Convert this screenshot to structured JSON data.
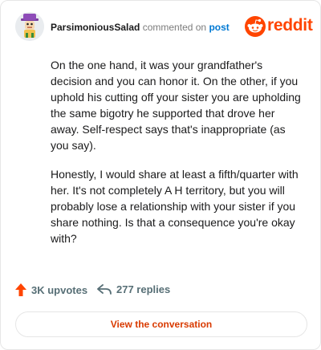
{
  "header": {
    "username": "ParsimoniousSalad",
    "verb": "commented on",
    "link_label": "post",
    "brand_text": "reddit"
  },
  "comment": {
    "paragraphs": [
      "On the one hand, it was your grandfather's decision and you can honor it. On the other, if you uphold his cutting off your sister you are upholding the same bigotry he supported that drove her away. Self-respect says that's inappropriate (as you say).",
      "Honestly, I would share at least a fifth/quarter with her. It's not completely A H territory, but you will probably lose a relationship with your sister if you share nothing. Is that a consequence you're okay with?"
    ]
  },
  "footer": {
    "upvotes": "3K upvotes",
    "replies": "277 replies"
  },
  "cta_label": "View the conversation",
  "colors": {
    "brand": "#ff4500",
    "link": "#0079d3",
    "cta_text": "#d93a00"
  },
  "icons": [
    "avatar-icon",
    "reddit-logo-icon",
    "upvote-arrow-icon",
    "reply-arrow-icon"
  ]
}
